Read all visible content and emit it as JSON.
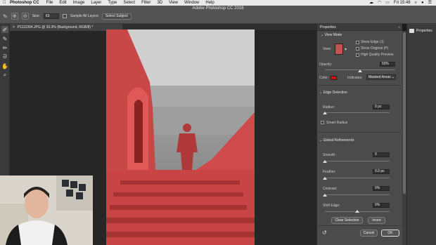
{
  "menubar": {
    "apple": "",
    "app_name": "Photoshop CC",
    "items": [
      "File",
      "Edit",
      "Image",
      "Layer",
      "Type",
      "Select",
      "Filter",
      "3D",
      "View",
      "Window",
      "Help"
    ],
    "clock": "Fri 15:48"
  },
  "window_title": "Adobe Photoshop CC 2018",
  "options": {
    "size_label": "Size:",
    "size_value": "63",
    "sample_all_layers": "Sample All Layers",
    "select_subject": "Select Subject"
  },
  "doc_tab": {
    "close": "×",
    "title": "P1111094.JPG @ 33.3% (Background, RGB/8) *"
  },
  "dock": {
    "properties_label": "Properties"
  },
  "properties": {
    "title": "Properties",
    "collapse": "«",
    "view_mode_header": "View Mode",
    "view_label": "View:",
    "show_edge": "Show Edge (J)",
    "show_original": "Show Original (P)",
    "high_quality_preview": "High Quality Preview",
    "opacity_label": "Opacity:",
    "opacity_value": "50%",
    "opacity": 0.5,
    "color_label": "Color:",
    "overlay_color": "#d41111",
    "indicates_label": "Indicates:",
    "indicates_value": "Masked Areas",
    "edge_detection_header": "Edge Detection",
    "radius_label": "Radius:",
    "radius_value": "0 px",
    "smart_radius": "Smart Radius",
    "global_refinements_header": "Global Refinements",
    "smooth_label": "Smooth:",
    "smooth_value": "0",
    "feather_label": "Feather:",
    "feather_value": "0.0 px",
    "contrast_label": "Contrast:",
    "contrast_value": "0%",
    "shift_edge_label": "Shift Edge:",
    "shift_edge_value": "0%",
    "clear_selection": "Clear Selection",
    "invert": "Invert",
    "cancel": "Cancel",
    "ok": "OK"
  }
}
